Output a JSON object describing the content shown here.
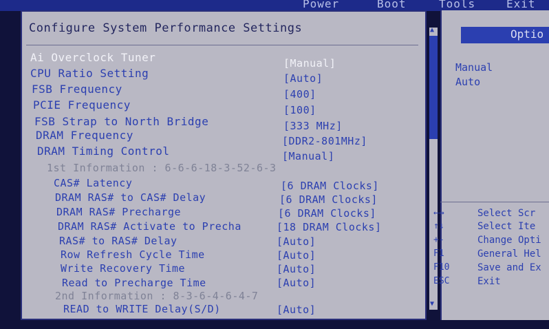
{
  "menu": {
    "tabs": [
      "Power",
      "Boot",
      "Tools",
      "Exit"
    ]
  },
  "panel": {
    "title": "Configure System Performance Settings"
  },
  "settings": [
    {
      "label": "Ai Overclock Tuner",
      "value": "[Manual]"
    },
    {
      "label": "CPU Ratio Setting",
      "value": "[Auto]"
    },
    {
      "label": "FSB Frequency",
      "value": "[400]"
    },
    {
      "label": "PCIE Frequency",
      "value": "[100]"
    },
    {
      "label": "FSB Strap to North Bridge",
      "value": "[333 MHz]"
    },
    {
      "label": "DRAM Frequency",
      "value": "[DDR2-801MHz]"
    },
    {
      "label": "DRAM Timing Control",
      "value": "[Manual]"
    },
    {
      "label": "1st Information : 6-6-6-18-3-52-6-3",
      "value": ""
    },
    {
      "label": "CAS# Latency",
      "value": "[6 DRAM Clocks]"
    },
    {
      "label": "DRAM RAS# to CAS# Delay",
      "value": "[6 DRAM Clocks]"
    },
    {
      "label": "DRAM RAS# Precharge",
      "value": "[6 DRAM Clocks]"
    },
    {
      "label": "DRAM RAS# Activate to Precha",
      "value": "[18 DRAM Clocks]"
    },
    {
      "label": "RAS# to RAS# Delay",
      "value": "[Auto]"
    },
    {
      "label": "Row Refresh Cycle Time",
      "value": "[Auto]"
    },
    {
      "label": "Write Recovery Time",
      "value": "[Auto]"
    },
    {
      "label": "Read to Precharge Time",
      "value": "[Auto]"
    },
    {
      "label": "2nd Information : 8-3-6-4-6-4-7",
      "value": ""
    },
    {
      "label": "READ to WRITE Delay(S/D)",
      "value": "[Auto]"
    }
  ],
  "options": {
    "header": "Optio",
    "items": [
      "Manual",
      "Auto"
    ]
  },
  "keys": [
    {
      "key": "←→",
      "desc": "Select Scr"
    },
    {
      "key": "↑↓",
      "desc": "Select Ite"
    },
    {
      "key": "+-",
      "desc": "Change Opti"
    },
    {
      "key": "F1",
      "desc": "General Hel"
    },
    {
      "key": "F10",
      "desc": "Save and Ex"
    },
    {
      "key": "ESC",
      "desc": "Exit"
    }
  ],
  "colors": {
    "highlight": "#f2f2f8",
    "item_text": "#2b3fb0",
    "info_text": "#7f8296",
    "panel_bg": "#b9b8c4"
  }
}
